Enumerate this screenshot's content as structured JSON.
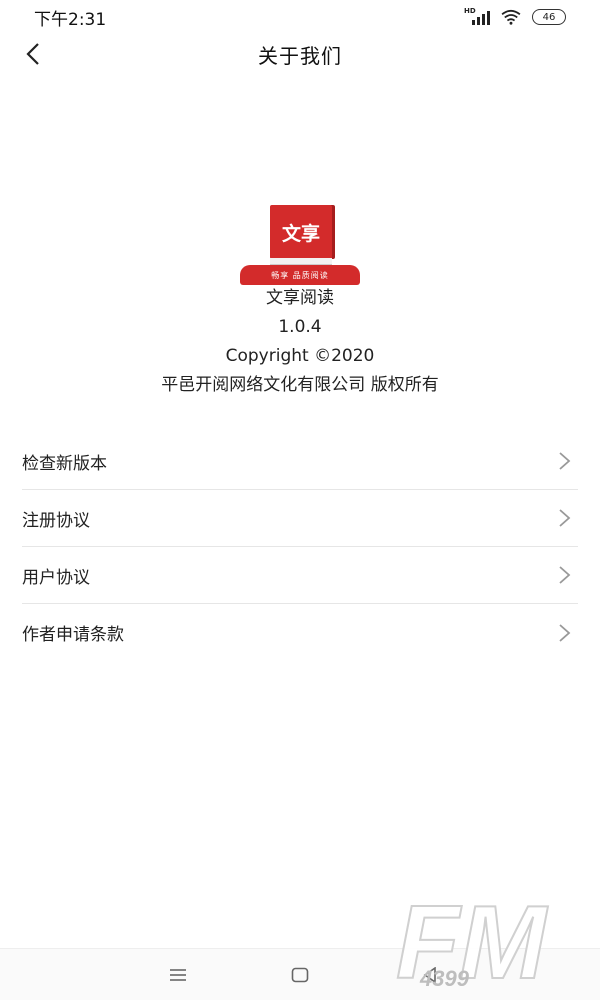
{
  "status_bar": {
    "time": "下午2:31",
    "network_label": "HD",
    "battery": "46",
    "icons": [
      "signal-icon",
      "wifi-icon",
      "battery-icon"
    ]
  },
  "header": {
    "title": "关于我们",
    "back_icon": "back-chevron-icon"
  },
  "app": {
    "logo_text": "文享",
    "logo_tagline": "畅享 品质阅读",
    "name": "文享阅读",
    "version": "1.0.4",
    "copyright": "Copyright ©2020",
    "company": "平邑开阅网络文化有限公司 版权所有"
  },
  "menu": {
    "items": [
      {
        "label": "检查新版本"
      },
      {
        "label": "注册协议"
      },
      {
        "label": "用户协议"
      },
      {
        "label": "作者申请条款"
      }
    ]
  },
  "nav": {
    "icons": [
      "menu-icon",
      "home-icon",
      "back-icon"
    ]
  },
  "watermark": {
    "text": "FM",
    "number": "4399"
  },
  "colors": {
    "brand_red": "#d32b2b",
    "divider": "#e6e6e6",
    "chevron": "#999999"
  }
}
